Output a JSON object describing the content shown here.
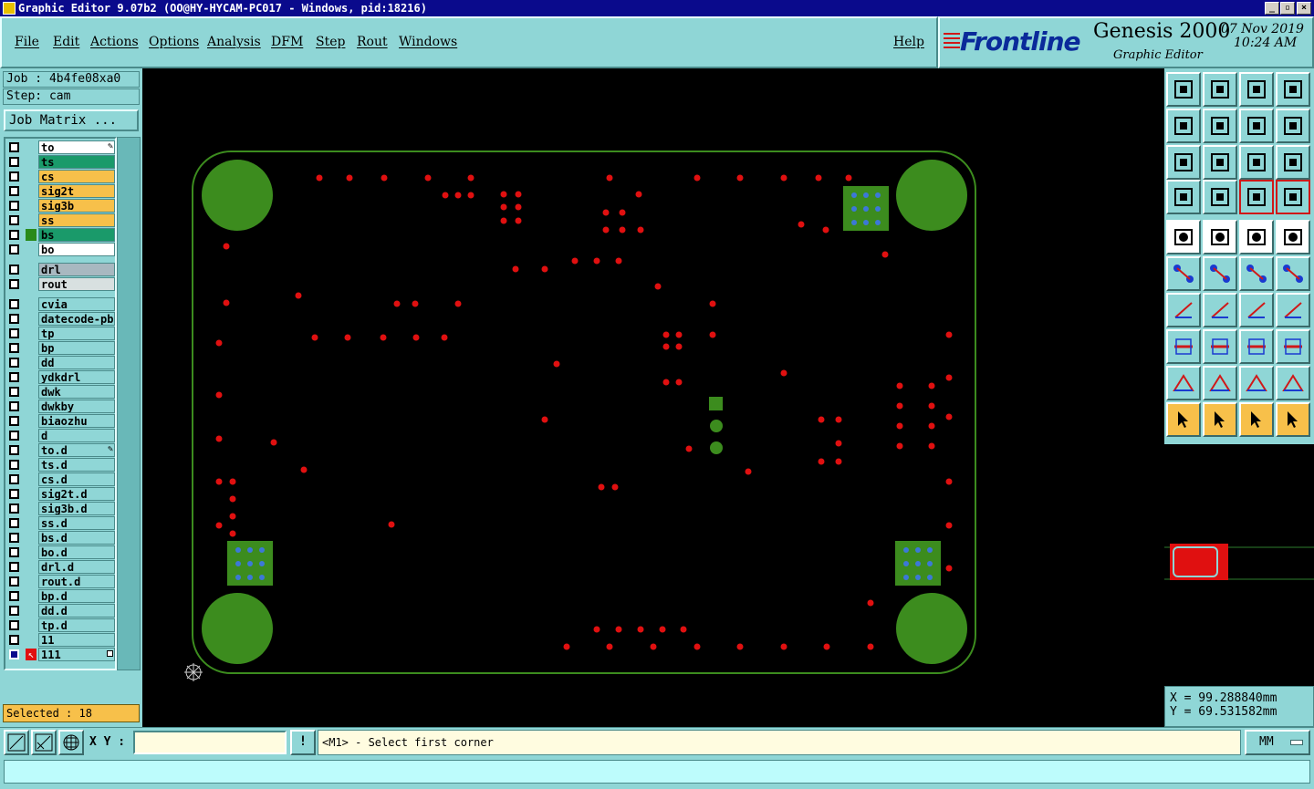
{
  "window": {
    "title": "Graphic Editor 9.07b2 (OO@HY-HYCAM-PC017 - Windows, pid:18216)",
    "min_glyph": "_",
    "max_glyph": "▫",
    "close_glyph": "×"
  },
  "menu": {
    "file": "File",
    "edit": "Edit",
    "actions": "Actions",
    "options": "Options",
    "analysis": "Analysis",
    "dfm": "DFM",
    "step": "Step",
    "rout": "Rout",
    "windows": "Windows",
    "help": "Help"
  },
  "brand": {
    "logo": "Frontline",
    "product": "Genesis 2000",
    "subtitle": "Graphic Editor",
    "date": "07 Nov 2019",
    "time": "10:24 AM"
  },
  "job": {
    "job_label": "Job : 4b4fe08xa0",
    "step_label": "Step: cam",
    "matrix_button": "Job Matrix ..."
  },
  "layers": [
    {
      "name": "to",
      "color": "#ffffff",
      "mark": "pen"
    },
    {
      "name": "ts",
      "color": "#1a9a6a"
    },
    {
      "name": "cs",
      "color": "#f7c04a"
    },
    {
      "name": "sig2t",
      "color": "#f7c04a"
    },
    {
      "name": "sig3b",
      "color": "#f7c04a"
    },
    {
      "name": "ss",
      "color": "#f7c04a"
    },
    {
      "name": "bs",
      "color": "#1a9a6a",
      "swatch": "#2a8a1a"
    },
    {
      "name": "bo",
      "color": "#ffffff"
    },
    {
      "name": "drl",
      "color": "#a8b8c0"
    },
    {
      "name": "rout",
      "color": "#d8e0e0"
    },
    {
      "name": "cvia",
      "color": "#8fd6d6"
    },
    {
      "name": "datecode-pbo",
      "color": "#8fd6d6"
    },
    {
      "name": "tp",
      "color": "#8fd6d6"
    },
    {
      "name": "bp",
      "color": "#8fd6d6"
    },
    {
      "name": "dd",
      "color": "#8fd6d6"
    },
    {
      "name": "ydkdrl",
      "color": "#8fd6d6"
    },
    {
      "name": "dwk",
      "color": "#8fd6d6"
    },
    {
      "name": "dwkby",
      "color": "#8fd6d6"
    },
    {
      "name": "biaozhu",
      "color": "#8fd6d6"
    },
    {
      "name": "d",
      "color": "#8fd6d6"
    },
    {
      "name": "to.d",
      "color": "#8fd6d6",
      "mark": "pen"
    },
    {
      "name": "ts.d",
      "color": "#8fd6d6"
    },
    {
      "name": "cs.d",
      "color": "#8fd6d6"
    },
    {
      "name": "sig2t.d",
      "color": "#8fd6d6"
    },
    {
      "name": "sig3b.d",
      "color": "#8fd6d6"
    },
    {
      "name": "ss.d",
      "color": "#8fd6d6"
    },
    {
      "name": "bs.d",
      "color": "#8fd6d6"
    },
    {
      "name": "bo.d",
      "color": "#8fd6d6"
    },
    {
      "name": "drl.d",
      "color": "#8fd6d6"
    },
    {
      "name": "rout.d",
      "color": "#8fd6d6"
    },
    {
      "name": "bp.d",
      "color": "#8fd6d6"
    },
    {
      "name": "dd.d",
      "color": "#8fd6d6"
    },
    {
      "name": "tp.d",
      "color": "#8fd6d6"
    },
    {
      "name": "11",
      "color": "#8fd6d6"
    },
    {
      "name": "111",
      "color": "#8fd6d6",
      "active": true
    }
  ],
  "selected": "Selected : 18",
  "coords": {
    "x": "X = 99.288840mm",
    "y": "Y = 69.531582mm"
  },
  "bottom": {
    "xy_label": "X Y :",
    "xy_value": "",
    "prompt": "<M1> - Select first corner",
    "units": "MM",
    "exclaim": "!"
  },
  "colors": {
    "board_outline": "#3c8c1e",
    "pad_green": "#3c8c1e",
    "via_red": "#e01010",
    "pad_hole_blue": "#3c78d8",
    "panel_bg": "#8fd6d6"
  }
}
